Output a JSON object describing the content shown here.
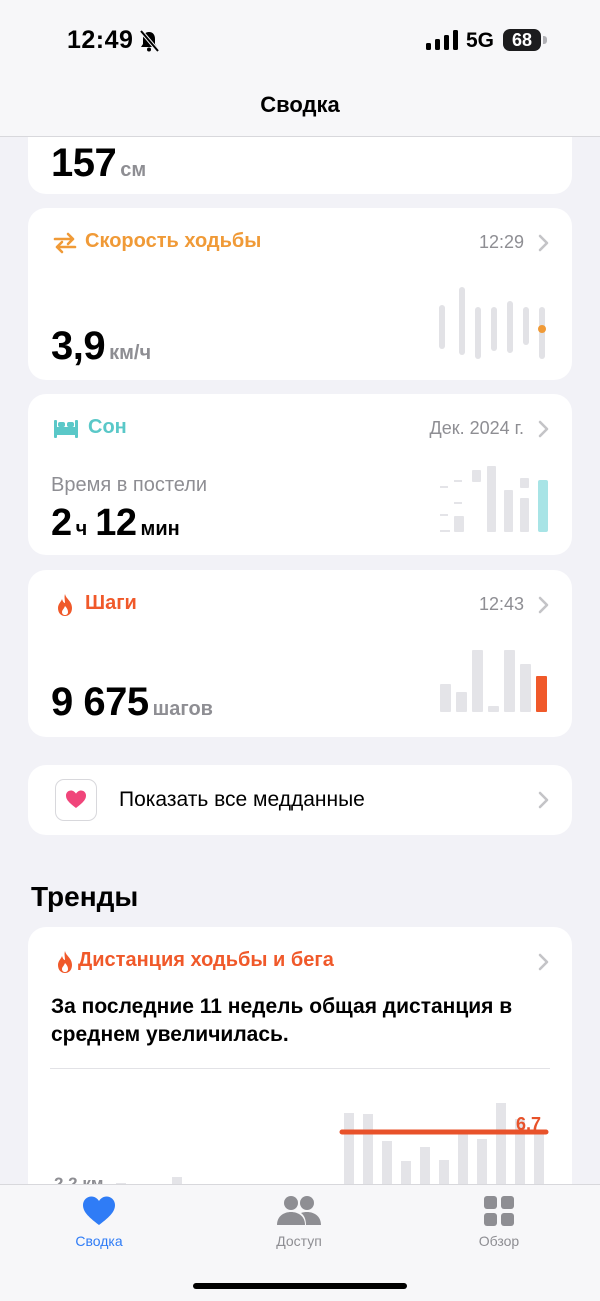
{
  "status": {
    "time": "12:49",
    "network": "5G",
    "battery": "68"
  },
  "nav": {
    "title": "Сводка"
  },
  "height_card": {
    "value": "157",
    "unit": "см"
  },
  "walking_speed": {
    "title": "Скорость ходьбы",
    "time": "12:29",
    "value": "3,9",
    "unit": "км/ч",
    "color": "#f09a37"
  },
  "sleep": {
    "title": "Сон",
    "date": "Дек. 2024 г.",
    "subtitle": "Время в постели",
    "hours": "2",
    "hours_unit": "ч",
    "minutes": "12",
    "minutes_unit": "мин",
    "color": "#5ac8c8"
  },
  "steps": {
    "title": "Шаги",
    "time": "12:43",
    "value": "9 675",
    "unit": "шагов",
    "color": "#f0592a"
  },
  "show_all": {
    "label": "Показать все медданные"
  },
  "trends": {
    "section_title": "Тренды",
    "title": "Дистанция ходьбы и бега",
    "description": "За последние 11 недель общая дистанция в среднем увеличилась.",
    "left_label": "2,2 км",
    "right_label": "6,7"
  },
  "tabbar": {
    "items": [
      {
        "label": "Сводка",
        "active": true
      },
      {
        "label": "Доступ",
        "active": false
      },
      {
        "label": "Обзор",
        "active": false
      }
    ],
    "active_color": "#2f7cf6",
    "inactive_color": "#8e8e93"
  }
}
